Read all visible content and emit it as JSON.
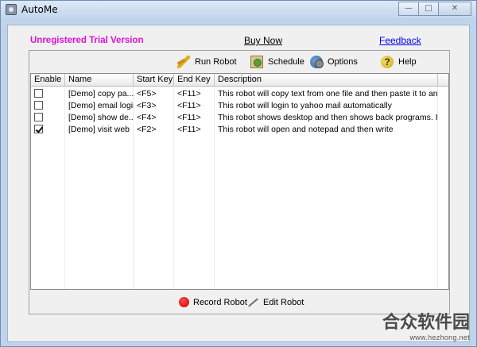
{
  "window": {
    "title": "AutoMe",
    "minimize": "—",
    "maximize": "□",
    "close": "✕"
  },
  "top": {
    "trial": "Unregistered Trial Version",
    "buy_now": "Buy Now",
    "feedback": "Feedback"
  },
  "toolbar": {
    "run_robot": "Run Robot",
    "schedule": "Schedule",
    "options": "Options",
    "help": "Help",
    "help_glyph": "?"
  },
  "table": {
    "columns": [
      "Enable",
      "Name",
      "Start Key",
      "End Key",
      "Description"
    ],
    "rows": [
      {
        "enabled": false,
        "name": "[Demo] copy pa...",
        "start": "<F5>",
        "end": "<F11>",
        "desc": "This robot will copy text from one file and then paste it to another f..."
      },
      {
        "enabled": false,
        "name": "[Demo] email login",
        "start": "<F3>",
        "end": "<F11>",
        "desc": "This robot will login to yahoo mail automatically"
      },
      {
        "enabled": false,
        "name": "[Demo] show de...",
        "start": "<F4>",
        "end": "<F11>",
        "desc": "This robot shows desktop and then shows back programs. It is cr..."
      },
      {
        "enabled": true,
        "name": "[Demo] visit web",
        "start": "<F2>",
        "end": "<F11>",
        "desc": "This robot will open and notepad and then write"
      }
    ]
  },
  "footer": {
    "record_robot": "Record Robot",
    "edit_robot": "Edit Robot"
  },
  "watermark": {
    "text": "合众软件园",
    "url": "www.hezhong.net"
  },
  "colors": {
    "trial": "#e011d8",
    "link": "#0000ee",
    "record": "#c80000"
  }
}
